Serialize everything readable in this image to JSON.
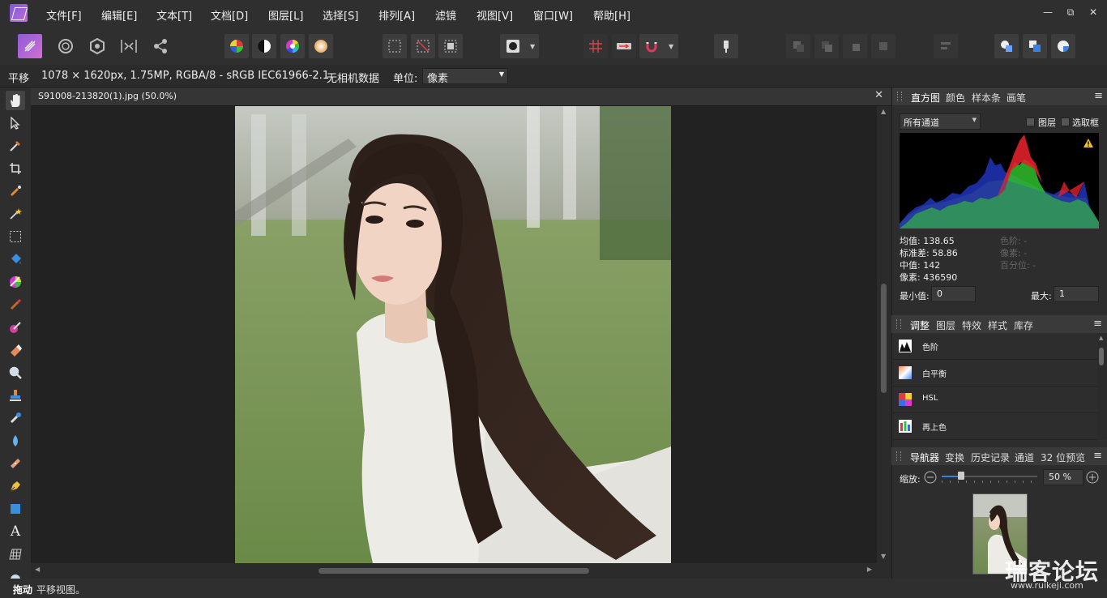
{
  "menubar": {
    "items": [
      "文件[F]",
      "编辑[E]",
      "文本[T]",
      "文档[D]",
      "图层[L]",
      "选择[S]",
      "排列[A]",
      "滤镜",
      "视图[V]",
      "窗口[W]",
      "帮助[H]"
    ],
    "window_controls": {
      "minimize": "—",
      "restore": "⧉",
      "close": "✕"
    }
  },
  "toolbar": {
    "icons": [
      "photo-persona-icon",
      "liquify-persona-icon",
      "develop-persona-icon",
      "tone-mapping-persona-icon",
      "export-persona-icon",
      "color-balance-icon",
      "black-white-icon",
      "hsl-wheel-icon",
      "gradient-icon",
      "marquee-select-icon",
      "deselect-icon",
      "invert-selection-icon",
      "quick-mask-icon",
      "snapping-grid-icon",
      "assistant-icon",
      "snapping-magnet-icon",
      "pin-icon"
    ]
  },
  "context": {
    "tool_name": "平移",
    "doc_info": "1078 × 1620px, 1.75MP, RGBA/8 - sRGB IEC61966-2.1",
    "camera_info": "无相机数据",
    "unit_label": "单位:",
    "unit_value": "像素"
  },
  "document": {
    "tab_title": "S91008-213820(1).jpg (50.0%)",
    "close": "✕"
  },
  "histogram_panel": {
    "tabs": [
      "直方图",
      "颜色",
      "样本条",
      "画笔"
    ],
    "channel": "所有通道",
    "checkbox_layer": "图层",
    "checkbox_selection": "选取框",
    "stats": {
      "mean": "均值: 138.65",
      "std": "标准差: 58.86",
      "median": "中值: 142",
      "pixels": "像素: 436590",
      "level": "色阶: -",
      "pixel2": "像素: -",
      "percentile": "百分位: -"
    },
    "min_label": "最小值:",
    "min_value": "0",
    "max_label": "最大:",
    "max_value": "1"
  },
  "adjust_panel": {
    "tabs": [
      "调整",
      "图层",
      "特效",
      "样式",
      "库存"
    ],
    "items": [
      "色阶",
      "白平衡",
      "HSL",
      "再上色"
    ]
  },
  "navigator_panel": {
    "tabs": [
      "导航器",
      "变换",
      "历史记录",
      "通道",
      "32 位预览"
    ],
    "zoom_label": "缩放:",
    "zoom_value": "50 %",
    "zoom_fraction": 0.5
  },
  "status": {
    "bold": "拖动",
    "text": "平移视图。"
  },
  "watermark": {
    "main": "瑞客论坛",
    "sub": "www.ruikeji.com"
  },
  "colors": {
    "accent": "#7b5cd6",
    "hist_red": "#e0202a",
    "hist_green": "#2fc02c",
    "hist_blue": "#1c2ea8"
  }
}
